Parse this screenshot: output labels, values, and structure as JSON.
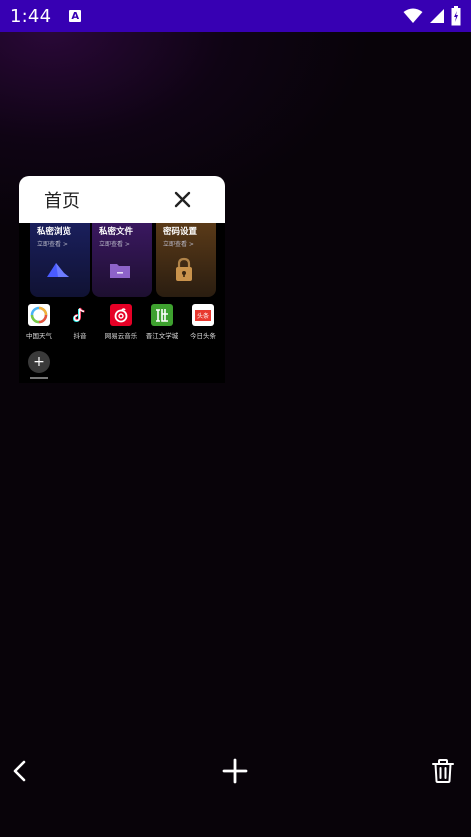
{
  "status_bar": {
    "time": "1:44",
    "notification_icon_letter": "A",
    "icons": [
      "wifi-icon",
      "signal-icon",
      "battery-icon"
    ]
  },
  "tab_card": {
    "title": "首页",
    "features": [
      {
        "title": "私密浏览",
        "subtitle": "立即查看 >",
        "icon": "private-browse-icon"
      },
      {
        "title": "私密文件",
        "subtitle": "立即查看 >",
        "icon": "folder-icon"
      },
      {
        "title": "密码设置",
        "subtitle": "立即查看 >",
        "icon": "lock-icon"
      }
    ],
    "apps": [
      {
        "label": "中国天气",
        "icon": "china-weather-icon"
      },
      {
        "label": "抖音",
        "icon": "douyin-icon"
      },
      {
        "label": "网易云音乐",
        "icon": "netease-music-icon"
      },
      {
        "label": "晋江文学城",
        "icon": "jinjiang-icon"
      },
      {
        "label": "今日头条",
        "icon": "toutiao-icon",
        "icon_text": "头条"
      }
    ],
    "add_app_icon": "plus-icon"
  },
  "bottom_bar": {
    "back_icon": "chevron-left-icon",
    "add_icon": "plus-icon",
    "trash_icon": "trash-icon"
  },
  "colors": {
    "status_bar": "#3700b3",
    "background": "#080309",
    "card_header": "#ffffff"
  }
}
